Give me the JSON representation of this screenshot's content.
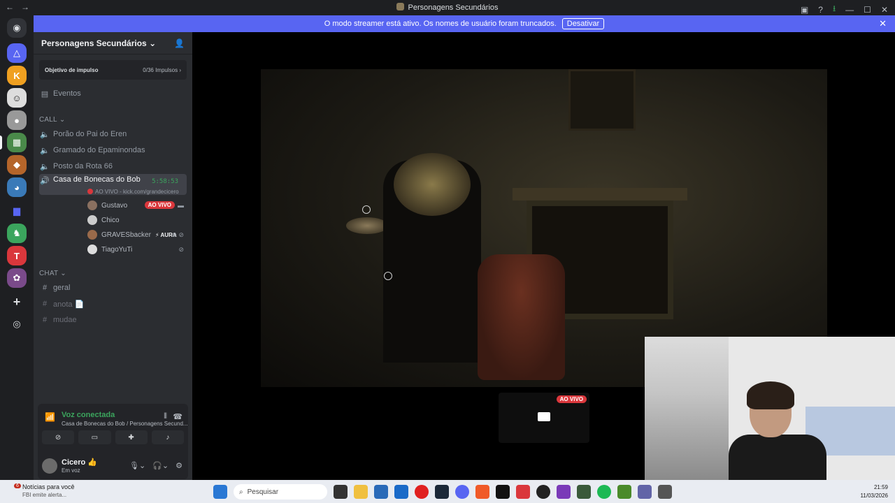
{
  "titlebar": {
    "title": "Personagens Secundários",
    "back": "←",
    "forward": "→"
  },
  "banner": {
    "text": "O modo streamer está ativo. Os nomes de usuário foram truncados.",
    "button": "Desativar",
    "close": "✕"
  },
  "server": {
    "name": "Personagens Secundários",
    "chevron": "⌄",
    "invite_icon": "👤"
  },
  "boost": {
    "label": "Objetivo de impulso",
    "value": "0/36 Impulsos",
    "chevron": "›"
  },
  "events": "Eventos",
  "categories": {
    "call": "CALL",
    "chat": "CHAT"
  },
  "voice_channels": [
    "Porão do Pai do Eren",
    "Gramado do Epaminondas",
    "Posto da Rota 66",
    "Casa de Bonecas do Bob"
  ],
  "active_channel": {
    "name": "Casa de Bonecas do Bob",
    "timer": "5:58:53",
    "sub": "AO VIVO - kick.com/grandecicero"
  },
  "members": [
    {
      "name": "Gustavo",
      "badge": "AO VIVO"
    },
    {
      "name": "Chico"
    },
    {
      "name": "GRAVESbacker",
      "tag": "⚡ AURA"
    },
    {
      "name": "TiagoYuTi"
    }
  ],
  "text_channels": [
    "geral",
    "anota 📄",
    "mudae"
  ],
  "voice_panel": {
    "title": "Voz conectada",
    "sub": "Casa de Bonecas do Bob / Personagens Secund..."
  },
  "user": {
    "name": "Cicero 👍",
    "status": "Em voz"
  },
  "stream": {
    "live_badge": "AO VIVO"
  },
  "taskbar": {
    "news_count": "6",
    "news_title": "Notícias para você",
    "news_sub": "FBI emite alerta...",
    "search_placeholder": "Pesquisar",
    "time": "21:59",
    "date": "11/03/2026"
  },
  "colors": {
    "accent": "#5865f2",
    "live": "#da373c",
    "connected": "#3ba55d"
  }
}
